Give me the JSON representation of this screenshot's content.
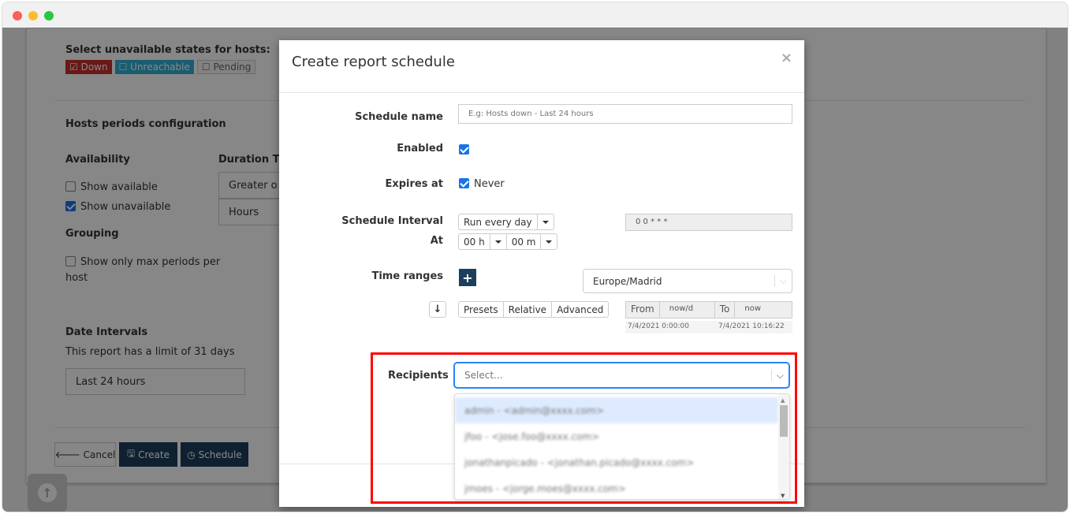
{
  "background": {
    "states_label": "Select unavailable states for hosts:",
    "states": [
      {
        "label": "Down",
        "color": "#c9302c",
        "checked": true
      },
      {
        "label": "Unreachable",
        "color": "#31b0d5",
        "checked": false
      },
      {
        "label": "Pending",
        "color": "#f5f5f5",
        "checked": false
      }
    ],
    "periods_title": "Hosts periods configuration",
    "availability_title": "Availability",
    "show_available": "Show available",
    "show_unavailable": "Show unavailable",
    "duration_title": "Duration Thr",
    "duration_operator": "Greater o",
    "duration_unit": "Hours",
    "grouping_title": "Grouping",
    "grouping_option": "Show only max periods per host",
    "date_intervals_title": "Date Intervals",
    "date_limit_text": "This report has a limit of 31 days",
    "date_interval_value": "Last 24 hours",
    "cancel": "Cancel",
    "create": "Create",
    "schedule": "Schedule"
  },
  "modal": {
    "title": "Create report schedule",
    "close": "×",
    "schedule_name_label": "Schedule name",
    "schedule_name_placeholder": "E.g: Hosts down - Last 24 hours",
    "enabled_label": "Enabled",
    "expires_label": "Expires at",
    "expires_never": "Never",
    "interval_label": "Schedule Interval",
    "interval_value": "Run every day",
    "cron": "0 0 * * *",
    "at_label": "At",
    "hour": "00 h",
    "minute": "00 m",
    "time_ranges_label": "Time ranges",
    "timezone": "Europe/Madrid",
    "range_tabs": [
      "Presets",
      "Relative",
      "Advanced"
    ],
    "from_label": "From",
    "from_value": "now/d",
    "to_label": "To",
    "to_value": "now",
    "from_resolved": "7/4/2021 0:00:00",
    "to_resolved": "7/4/2021 10:16:22",
    "recipients_label": "Recipients",
    "recipients_placeholder": "Select...",
    "recipients_options": [
      "admin - <admin@xxxx.com>",
      "jfoo - <jose.foo@xxxx.com>",
      "jonathanpicado - <jonathan.picado@xxxx.com>",
      "jmoes - <jorge.moes@xxxx.com>"
    ],
    "highlight_color": "#ff0000",
    "accent_color": "#1d3f5e"
  }
}
